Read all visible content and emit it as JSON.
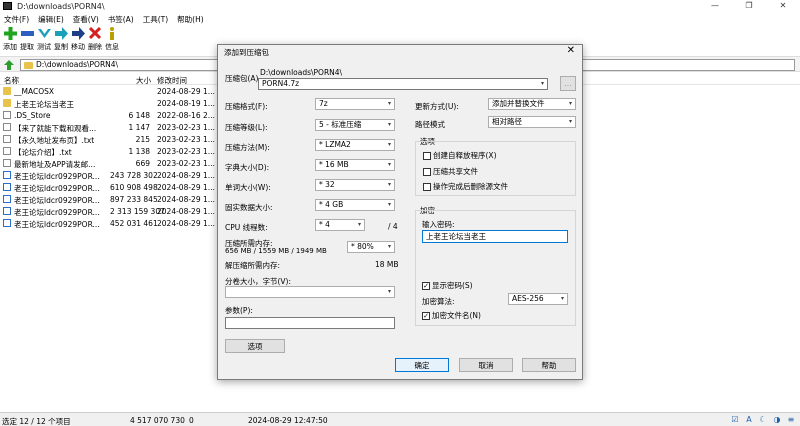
{
  "window": {
    "title": "D:\\downloads\\PORN4\\",
    "minimize": "—",
    "maximize": "❐",
    "close": "✕"
  },
  "menu": [
    "文件(F)",
    "编辑(E)",
    "查看(V)",
    "书签(A)",
    "工具(T)",
    "帮助(H)"
  ],
  "toolbar": [
    {
      "label": "添加",
      "icon": "add-icon",
      "color": "#1fa51f"
    },
    {
      "label": "提取",
      "icon": "extract-icon",
      "color": "#2b5fc0"
    },
    {
      "label": "测试",
      "icon": "test-icon",
      "color": "#1aa0b8"
    },
    {
      "label": "复制",
      "icon": "copy-icon",
      "color": "#1aa0b8"
    },
    {
      "label": "移动",
      "icon": "move-icon",
      "color": "#1d3f8a"
    },
    {
      "label": "删除",
      "icon": "delete-icon",
      "color": "#d42020"
    },
    {
      "label": "信息",
      "icon": "info-icon",
      "color": "#b8a000"
    }
  ],
  "address": "D:\\downloads\\PORN4\\",
  "columns": {
    "name": "名称",
    "size": "大小",
    "modified": "修改时间"
  },
  "files": [
    {
      "name": "__MACOSX",
      "size": "",
      "date": "2024-08-29 1...",
      "type": "folder"
    },
    {
      "name": "上老王论坛当老王",
      "size": "",
      "date": "2024-08-19 1...",
      "type": "folder"
    },
    {
      "name": ".DS_Store",
      "size": "6 148",
      "date": "2022-08-16 2...",
      "type": "doc"
    },
    {
      "name": "【来了就能下载和观看...",
      "size": "1 147",
      "date": "2023-02-23 1...",
      "type": "doc"
    },
    {
      "name": "【永久地址发布页】.txt",
      "size": "215",
      "date": "2023-02-23 1...",
      "type": "doc"
    },
    {
      "name": "【论坛介绍】.txt",
      "size": "1 138",
      "date": "2023-02-23 1...",
      "type": "doc"
    },
    {
      "name": "最新地址及APP请发邮...",
      "size": "669",
      "date": "2023-02-23 1...",
      "type": "doc"
    },
    {
      "name": "老王论坛ldcr0929POR...",
      "size": "243 728 302",
      "date": "2024-08-29 1...",
      "type": "zip"
    },
    {
      "name": "老王论坛ldcr0929POR...",
      "size": "610 908 498",
      "date": "2024-08-29 1...",
      "type": "zip"
    },
    {
      "name": "老王论坛ldcr0929POR...",
      "size": "897 233 845",
      "date": "2024-08-29 1...",
      "type": "zip"
    },
    {
      "name": "老王论坛ldcr0929POR...",
      "size": "2 313 159 307",
      "date": "2024-08-29 1...",
      "type": "zip"
    },
    {
      "name": "老王论坛ldcr0929POR...",
      "size": "452 031 461",
      "date": "2024-08-29 1...",
      "type": "zip"
    }
  ],
  "status": {
    "selected": "选定 12 / 12 个项目",
    "total": "4 517 070 730",
    "zero": "0",
    "datetime": "2024-08-29 12:47:50",
    "icons": [
      "☑",
      "A",
      "☾",
      "◑",
      "≡"
    ]
  },
  "dialog": {
    "title": "添加到压缩包",
    "close": "✕",
    "archive_label": "压缩包(A)",
    "archive_path": "D:\\downloads\\PORN4\\",
    "archive_name": "PORN4.7z",
    "browse": "...",
    "format_label": "压缩格式(F):",
    "format_value": "7z",
    "level_label": "压缩等级(L):",
    "level_value": "5 - 标准压缩",
    "method_label": "压缩方法(M):",
    "method_value": "* LZMA2",
    "dict_label": "字典大小(D):",
    "dict_value": "* 16 MB",
    "word_label": "单词大小(W):",
    "word_value": "* 32",
    "solid_label": "固实数据大小:",
    "solid_value": "* 4 GB",
    "threads_label": "CPU 线程数:",
    "threads_value": "* 4",
    "threads_max": "/ 4",
    "mem_label": "压缩所需内存:",
    "mem_detail": "656 MB / 1559 MB / 1949 MB",
    "mem_value": "* 80%",
    "demem_label": "解压缩所需内存:",
    "demem_value": "18 MB",
    "split_label": "分卷大小，字节(V):",
    "params_label": "参数(P):",
    "options_button": "选项",
    "update_label": "更新方式(U):",
    "update_value": "添加并替换文件",
    "pathmode_label": "路径模式",
    "pathmode_value": "相对路径",
    "options_group": "选项",
    "opt_sfx": "创建自释放程序(X)",
    "opt_shared": "压缩共享文件",
    "opt_delete": "操作完成后删除源文件",
    "enc_group": "加密",
    "pwd_label": "输入密码:",
    "pwd_value": "上老王论坛当老王",
    "show_pwd": "显示密码(S)",
    "enc_method_label": "加密算法:",
    "enc_method_value": "AES-256",
    "enc_names": "加密文件名(N)",
    "ok": "确定",
    "cancel": "取消",
    "help": "帮助"
  }
}
